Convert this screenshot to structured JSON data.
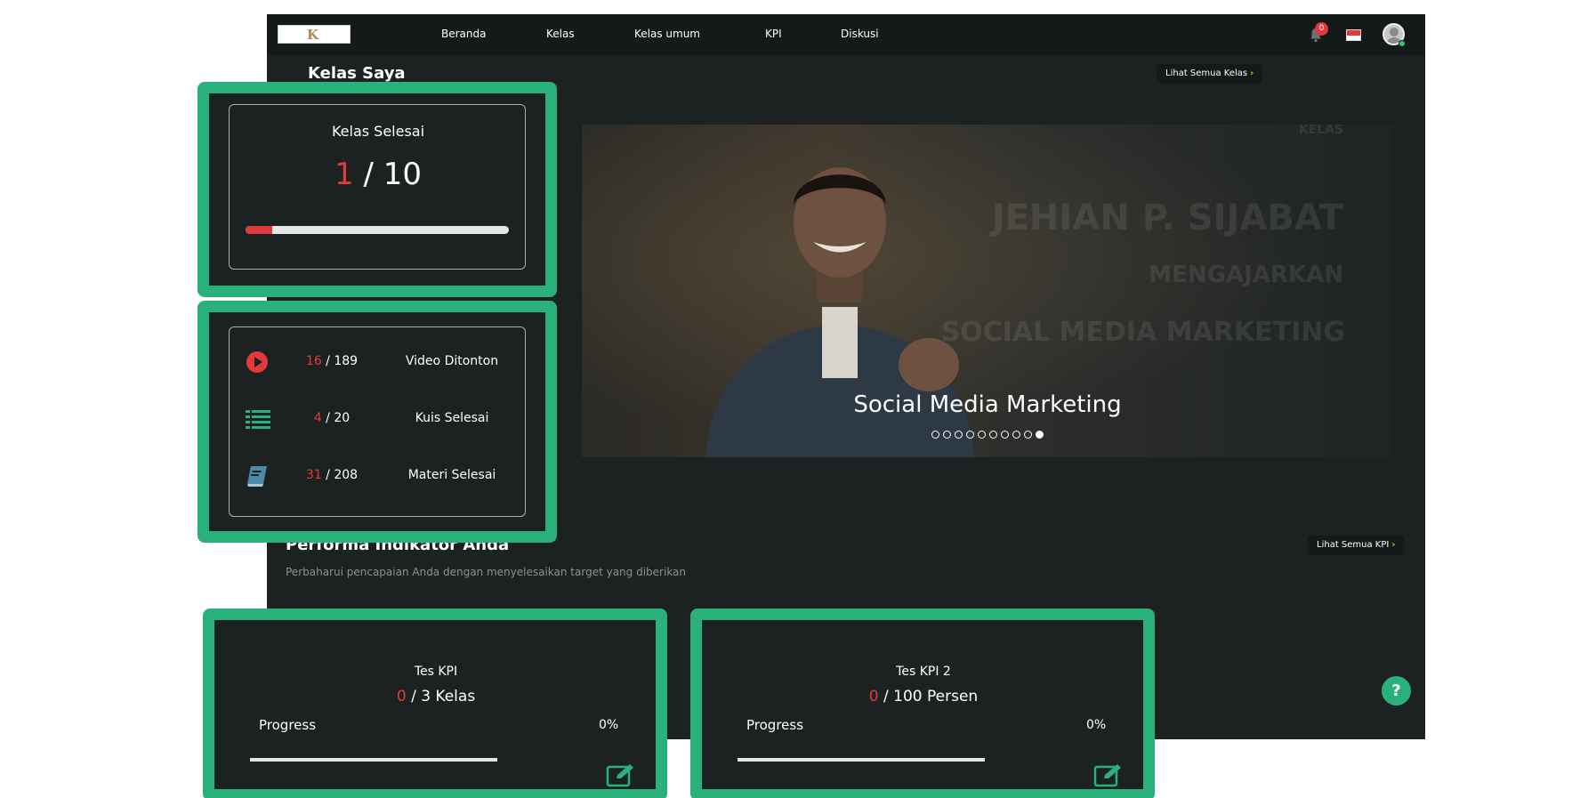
{
  "navbar": {
    "logo_text": "K",
    "items": [
      "Beranda",
      "Kelas",
      "Kelas umum",
      "KPI",
      "Diskusi"
    ],
    "notification_count": "0",
    "notification_icon": "bell-icon",
    "flag": "indonesia-flag",
    "flag_colors": [
      "#e03a3a",
      "#ffffff"
    ]
  },
  "kelas_saya": {
    "title": "Kelas Saya",
    "see_all_label": "Lihat Semua Kelas",
    "see_all_icon": "chevron-right-icon"
  },
  "kelas_selesai": {
    "title": "Kelas Selesai",
    "done": "1",
    "separator": "/",
    "total": "10",
    "progress_fraction": 0.1
  },
  "stats": [
    {
      "icon": "play-circle-icon",
      "done": "16",
      "total": "189",
      "label": "Video Ditonton",
      "icon_color": "#e03a3a"
    },
    {
      "icon": "list-icon",
      "done": "4",
      "total": "20",
      "label": "Kuis Selesai",
      "icon_color": "#2ab07a"
    },
    {
      "icon": "book-icon",
      "done": "31",
      "total": "208",
      "label": "Materi Selesai",
      "icon_color": "#4a8aa8"
    }
  ],
  "banner": {
    "top_word": "KELAS",
    "instructor": "JEHIAN P. SIJABAT",
    "teaches": "MENGAJARKAN",
    "course_upper": "SOCIAL MEDIA MARKETING",
    "caption": "Social Media Marketing",
    "slide_count": 10,
    "active_slide": 10
  },
  "performa": {
    "title": "Performa Indikator Anda",
    "subtitle": "Perbaharui pencapaian Anda dengan menyelesaikan target yang diberikan",
    "see_all_label": "Lihat Semua KPI",
    "see_all_icon": "chevron-right-icon"
  },
  "kpi_cards": [
    {
      "title": "Tes KPI",
      "done": "0",
      "rest": "/ 3 Kelas",
      "progress_label": "Progress",
      "percent_label": "0%",
      "progress_fraction": 0.0,
      "edit_icon": "edit-icon"
    },
    {
      "title": "Tes KPI 2",
      "done": "0",
      "rest": "/ 100 Persen",
      "progress_label": "Progress",
      "percent_label": "0%",
      "progress_fraction": 0.0,
      "edit_icon": "edit-icon"
    }
  ],
  "help": {
    "label": "?",
    "icon": "help-icon"
  },
  "colors": {
    "accent_green": "#2ab07a",
    "accent_red": "#e03a3a",
    "app_background": "#1c2222",
    "navbar_background": "#141a1a"
  }
}
